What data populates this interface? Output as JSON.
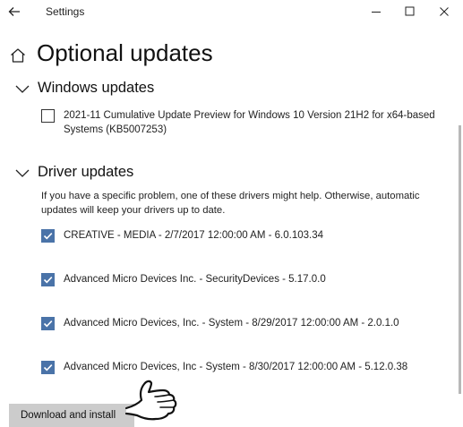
{
  "window": {
    "title": "Settings",
    "controls": {
      "back": "back-arrow-icon",
      "minimize": "minimize-icon",
      "maximize": "maximize-icon",
      "close": "close-icon"
    }
  },
  "page": {
    "title": "Optional updates",
    "icon": "home-icon"
  },
  "windows_updates": {
    "heading": "Windows updates",
    "items": [
      {
        "label": "2021-11 Cumulative Update Preview for Windows 10 Version 21H2 for x64-based Systems (KB5007253)",
        "checked": false
      }
    ]
  },
  "driver_updates": {
    "heading": "Driver updates",
    "description": "If you have a specific problem, one of these drivers might help. Otherwise, automatic updates will keep your drivers up to date.",
    "items": [
      {
        "label": "CREATIVE - MEDIA - 2/7/2017 12:00:00 AM - 6.0.103.34",
        "checked": true
      },
      {
        "label": "Advanced Micro Devices Inc. - SecurityDevices - 5.17.0.0",
        "checked": true
      },
      {
        "label": "Advanced Micro Devices, Inc. - System - 8/29/2017 12:00:00 AM - 2.0.1.0",
        "checked": true
      },
      {
        "label": "Advanced Micro Devices, Inc - System - 8/30/2017 12:00:00 AM - 5.12.0.38",
        "checked": true
      }
    ]
  },
  "actions": {
    "download_install": "Download and install"
  },
  "colors": {
    "accent": "#4a73a8",
    "button_bg": "#cccccc"
  },
  "pointer": "pointing-hand-icon"
}
